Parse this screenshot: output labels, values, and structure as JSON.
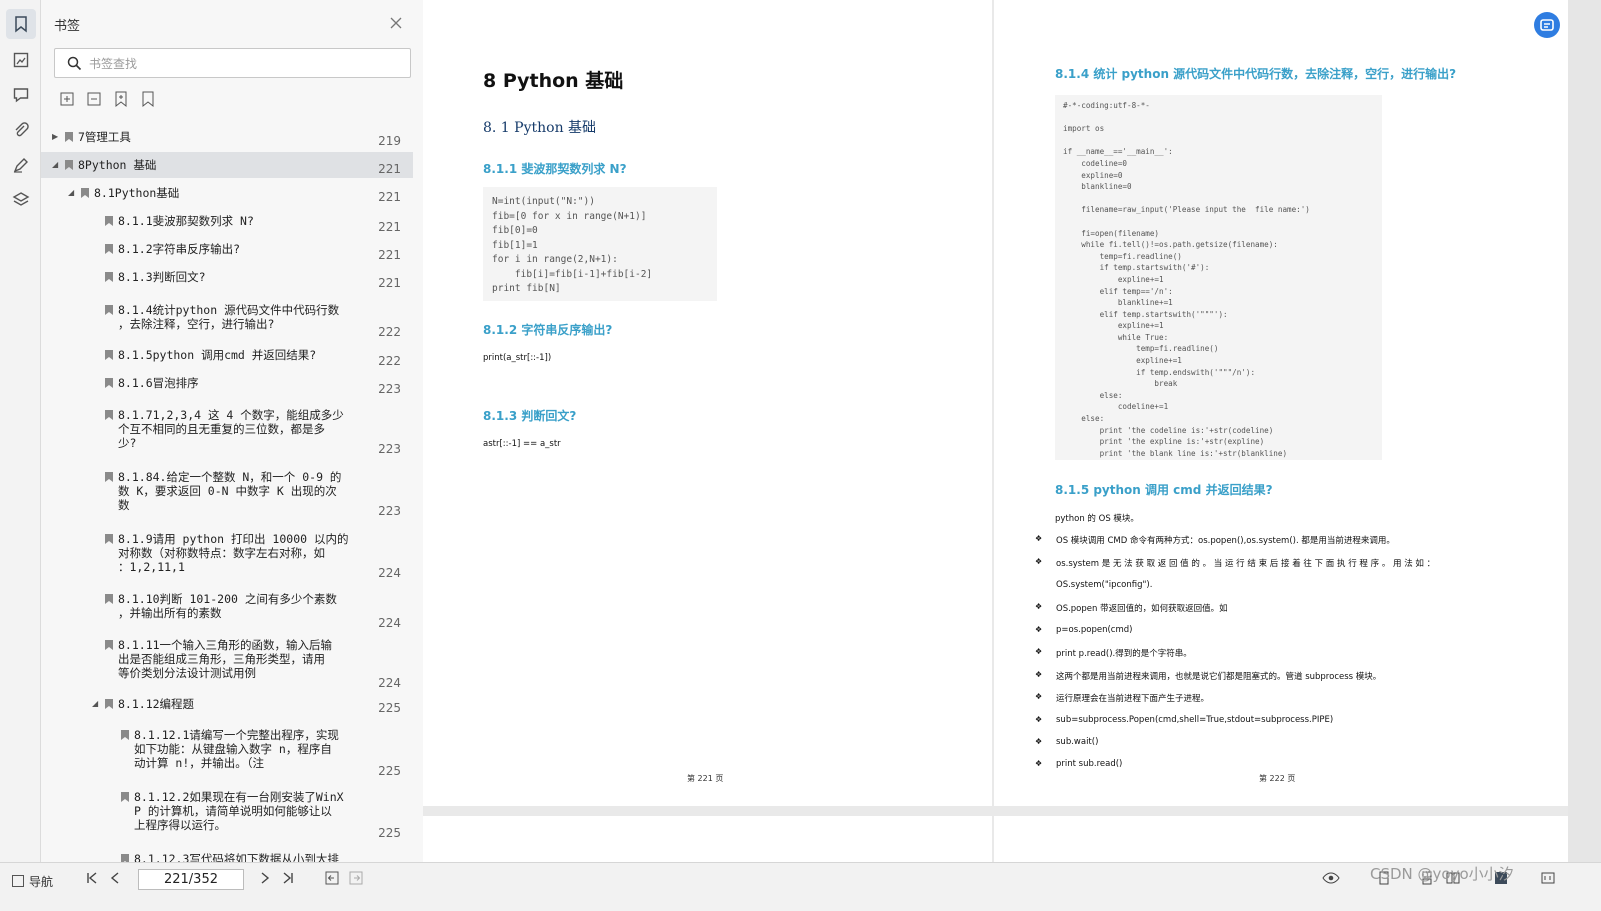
{
  "panel": {
    "title": "书签",
    "search_placeholder": "书签查找"
  },
  "rail_icons": [
    "bookmark-icon",
    "thumbnail-icon",
    "comment-icon",
    "attachment-icon",
    "signature-icon",
    "layers-icon"
  ],
  "bookmarks": [
    {
      "label": "7管理工具",
      "page": "219"
    },
    {
      "label": "8Python 基础",
      "page": "221"
    },
    {
      "label": "8.1Python基础",
      "page": "221"
    },
    {
      "label": "8.1.1斐波那契数列求 N?",
      "page": "221"
    },
    {
      "label": "8.1.2字符串反序输出?",
      "page": "221"
    },
    {
      "label": "8.1.3判断回文?",
      "page": "221"
    },
    {
      "label": "8.1.4统计python 源代码文件中代码行数\n，去除注释，空行，进行输出?",
      "page": "222"
    },
    {
      "label": "8.1.5python 调用cmd 并返回结果?",
      "page": "222"
    },
    {
      "label": "8.1.6冒泡排序",
      "page": "223"
    },
    {
      "label": "8.1.71,2,3,4 这 4 个数字，能组成多少\n个互不相同的且无重复的三位数，都是多\n少?",
      "page": "223"
    },
    {
      "label": "8.1.84.给定一个整数 N，和一个 0-9 的\n数 K，要求返回 0-N 中数字 K 出现的次\n数",
      "page": "223"
    },
    {
      "label": "8.1.9请用 python 打印出 10000 以内的\n对称数（对称数特点：数字左右对称，如\n：1,2,11,1",
      "page": "224"
    },
    {
      "label": "8.1.10判断 101-200 之间有多少个素数\n，并输出所有的素数",
      "page": "224"
    },
    {
      "label": "8.1.11一个输入三角形的函数，输入后输\n出是否能组成三角形，三角形类型，请用\n等价类划分法设计测试用例",
      "page": "224"
    },
    {
      "label": "8.1.12编程题",
      "page": "225"
    },
    {
      "label": "8.1.12.1请编写一个完整出程序，实现\n如下功能：从键盘输入数字 n，程序自\n动计算 n!，并输出。（注",
      "page": "225"
    },
    {
      "label": "8.1.12.2如果现在有一台刚安装了WinX\nP 的计算机，请简单说明如何能够让以\n上程序得以运行。",
      "page": "225"
    },
    {
      "label": "8.1.12.3写代码将如下数据从小到大排",
      "page": ""
    }
  ],
  "page221": {
    "h1": "8  Python  基础",
    "h2": "8. 1  Python 基础",
    "s1": "8.1.1  斐波那契数列求  N?",
    "code1": "N=int(input(\"N:\"))\nfib=[0 for x in range(N+1)]\nfib[0]=0\nfib[1]=1\nfor i in range(2,N+1):\n    fib[i]=fib[i-1]+fib[i-2]\nprint fib[N]",
    "s2": "8.1.2  字符串反序输出?",
    "t2": "print(a_str[::-1])",
    "s3": "8.1.3  判断回文?",
    "t3": "astr[::-1] == a_str",
    "footer": "第  221  页"
  },
  "page222": {
    "s4": "8.1.4  统计 python  源代码文件中代码行数，去除注释，空行，进行输出?",
    "code4": "#-*-coding:utf-8-*-\n\nimport os\n\nif __name__=='__main__':\n    codeline=0\n    expline=0\n    blankline=0\n\n    filename=raw_input('Please input the  file name:')\n\n    fi=open(filename)\n    while fi.tell()!=os.path.getsize(filename):\n        temp=fi.readline()\n        if temp.startswith('#'):\n            expline+=1\n        elif temp=='/n':\n            blankline+=1\n        elif temp.startswith('\"\"\"'):\n            expline+=1\n            while True:\n                temp=fi.readline()\n                expline+=1\n                if temp.endswith('\"\"\"/n'):\n                    break\n        else:\n            codeline+=1\n    else:\n        print 'the codeline is:'+str(codeline)\n        print 'the expline is:'+str(expline)\n        print 'the blank line is:'+str(blankline)",
    "s5": "8.1.5  python  调用 cmd  并返回结果?",
    "intro": "python  的  OS  模块。",
    "bullets": [
      "OS  模块调用 CMD  命令有两种方式：os.popen(),os.system().  都是用当前进程来调用。",
      "os.system  是 无 法 获 取 返 回 值 的 。  当 运 行 结 束 后 接 着 往 下 面 执 行 程 序 。  用 法 如 ：",
      "OS.popen  带返回值的，如何获取返回值。如",
      "p=os.popen(cmd)",
      "print p.read().得到的是个字符串。",
      "这两个都是用当前进程来调用，也就是说它们都是阻塞式的。管道  subprocess  模块。",
      "运行原理会在当前进程下面产生子进程。",
      "sub=subprocess.Popen(cmd,shell=True,stdout=subprocess.PIPE)",
      "sub.wait()",
      "print sub.read()"
    ],
    "cont": "OS.system(\"ipconfig\").",
    "footer": "第  222  页"
  },
  "status": {
    "nav_label": "导航",
    "page_value": "221/352",
    "watermark": "CSDN @yoyo小小汐"
  }
}
